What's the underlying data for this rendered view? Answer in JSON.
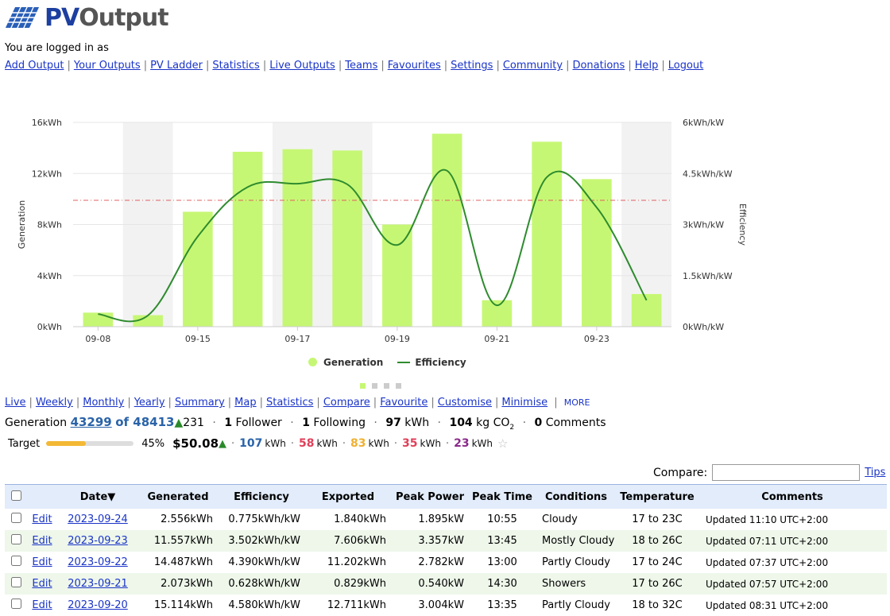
{
  "logo": {
    "text_pv": "PV",
    "text_output": "Output"
  },
  "login_text": "You are logged in as",
  "top_nav": [
    "Add Output",
    "Your Outputs",
    "PV Ladder",
    "Statistics",
    "Live Outputs",
    "Teams",
    "Favourites",
    "Settings",
    "Community",
    "Donations",
    "Help",
    "Logout"
  ],
  "chart_data": {
    "type": "bar",
    "categories": [
      "09-08",
      "09-09",
      "09-15",
      "09-16",
      "09-17",
      "09-18",
      "09-19",
      "09-20",
      "09-21",
      "09-22",
      "09-23",
      "09-24"
    ],
    "x_tick_labels": [
      "09-08",
      "09-15",
      "09-17",
      "09-19",
      "09-21",
      "09-23"
    ],
    "series": [
      {
        "name": "Generation",
        "type": "bar",
        "unit": "kWh",
        "values": [
          1.1,
          0.9,
          9.0,
          13.7,
          13.9,
          13.8,
          8.0,
          15.114,
          2.073,
          14.487,
          11.557,
          2.556
        ]
      },
      {
        "name": "Efficiency",
        "type": "line",
        "unit": "kWh/kW",
        "values": [
          0.37,
          0.33,
          2.65,
          4.1,
          4.2,
          4.18,
          2.4,
          4.58,
          0.628,
          4.39,
          3.502,
          0.775
        ]
      }
    ],
    "ylabel": "Generation",
    "y2label": "Efficiency",
    "ylim": [
      0,
      16
    ],
    "y2lim": [
      0,
      6
    ],
    "y_ticks": [
      "0kWh",
      "4kWh",
      "8kWh",
      "12kWh",
      "16kWh"
    ],
    "y2_ticks": [
      "0kWh/kW",
      "1.5kWh/kW",
      "3kWh/kW",
      "4.5kWh/kW",
      "6kWh/kW"
    ],
    "target_line": 9.9,
    "shaded_bands": [
      [
        1,
        2
      ],
      [
        4,
        6
      ],
      [
        11,
        12
      ]
    ],
    "colors": {
      "bar": "#c6f774",
      "line": "#2e8b2e",
      "target": "#e06060",
      "band": "#f2f2f2"
    },
    "legend_position": "bottom-center"
  },
  "sub_nav": [
    "Live",
    "Weekly",
    "Monthly",
    "Yearly",
    "Summary",
    "Map",
    "Statistics",
    "Compare",
    "Favourite",
    "Customise",
    "Minimise"
  ],
  "sub_nav_more": "MORE",
  "generation": {
    "label": "Generation",
    "value": "43299",
    "of_total": "of 48413",
    "delta": "231",
    "followers_count": "1",
    "followers_label": "Follower",
    "following_count": "1",
    "following_label": "Following",
    "kwh_value": "97",
    "kwh_unit": "kWh",
    "co2_value": "104",
    "co2_unit": "kg CO",
    "co2_sub": "2",
    "comments_count": "0",
    "comments_label": "Comments"
  },
  "target": {
    "label": "Target",
    "percent": "45%",
    "progress": 0.45,
    "money": "$50.08",
    "values": [
      {
        "value": "107",
        "unit": "kWh",
        "color": "#2a63a8"
      },
      {
        "value": "58",
        "unit": "kWh",
        "color": "#e0405a"
      },
      {
        "value": "83",
        "unit": "kWh",
        "color": "#f0b030"
      },
      {
        "value": "35",
        "unit": "kWh",
        "color": "#e0405a"
      },
      {
        "value": "23",
        "unit": "kWh",
        "color": "#8a2a8a"
      }
    ]
  },
  "compare": {
    "label": "Compare:",
    "value": "",
    "tips": "Tips"
  },
  "table": {
    "headers": [
      "Date▼",
      "Generated",
      "Efficiency",
      "Exported",
      "Peak Power",
      "Peak Time",
      "Conditions",
      "Temperature",
      "Comments"
    ],
    "edit_label": "Edit",
    "rows": [
      {
        "date": "2023-09-24",
        "generated": "2.556kWh",
        "efficiency": "0.775kWh/kW",
        "exported": "1.840kWh",
        "peak_power": "1.895kW",
        "peak_time": "10:55",
        "conditions": "Cloudy",
        "temperature": "17 to 23C",
        "comments": "Updated 11:10 UTC+2:00"
      },
      {
        "date": "2023-09-23",
        "generated": "11.557kWh",
        "efficiency": "3.502kWh/kW",
        "exported": "7.606kWh",
        "peak_power": "3.357kW",
        "peak_time": "13:45",
        "conditions": "Mostly Cloudy",
        "temperature": "18 to 26C",
        "comments": "Updated 07:11 UTC+2:00"
      },
      {
        "date": "2023-09-22",
        "generated": "14.487kWh",
        "efficiency": "4.390kWh/kW",
        "exported": "11.202kWh",
        "peak_power": "2.782kW",
        "peak_time": "13:00",
        "conditions": "Partly Cloudy",
        "temperature": "17 to 24C",
        "comments": "Updated 07:37 UTC+2:00"
      },
      {
        "date": "2023-09-21",
        "generated": "2.073kWh",
        "efficiency": "0.628kWh/kW",
        "exported": "0.829kWh",
        "peak_power": "0.540kW",
        "peak_time": "14:30",
        "conditions": "Showers",
        "temperature": "17 to 26C",
        "comments": "Updated 07:57 UTC+2:00"
      },
      {
        "date": "2023-09-20",
        "generated": "15.114kWh",
        "efficiency": "4.580kWh/kW",
        "exported": "12.711kWh",
        "peak_power": "3.004kW",
        "peak_time": "13:35",
        "conditions": "Partly Cloudy",
        "temperature": "18 to 32C",
        "comments": "Updated 08:31 UTC+2:00"
      }
    ]
  }
}
